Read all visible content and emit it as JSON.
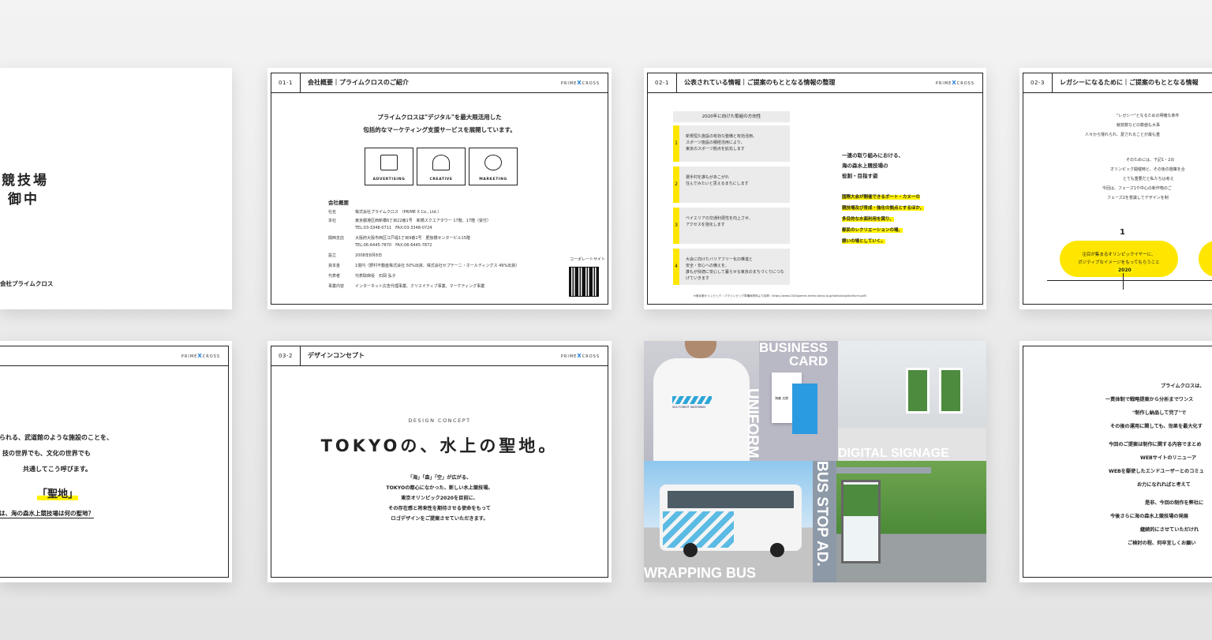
{
  "slide_a": {
    "line1": "競技場",
    "line2": "御中",
    "footer": "会社プライムクロス"
  },
  "slide_b": {
    "num": "01-1",
    "title": "会社概要｜プライムクロスのご紹介",
    "logo_left": "PRIME",
    "logo_x": "X",
    "logo_right": "CROSS",
    "lead1": "プライムクロスは\"デジタル\"を最大限活用した",
    "lead2": "包括的なマーケティング支援サービスを展開しています。",
    "services": [
      "ADVERTISING",
      "CREATIVE",
      "MARKETING"
    ],
    "company_heading": "会社概要",
    "rows": [
      {
        "k": "社名",
        "v": "株式会社プライムクロス （PRIME X Co., Ltd.）"
      },
      {
        "k": "本社",
        "v": "東京都港区西新橋6丁目22番1号　新橋スクエアタワー 17階、17階（受付）"
      },
      {
        "k": "",
        "v": "TEL:03-3348-0711　FAX:03-3348-0724"
      },
      {
        "k": "関西支店",
        "v": "大阪府大阪市西区江戸堀1丁目9番1号　肥後橋センタービル15階"
      },
      {
        "k": "",
        "v": "TEL:06-6445-7870　FAX:06-6445-7872"
      },
      {
        "k": "設立",
        "v": "2008年8月8日"
      },
      {
        "k": "資本金",
        "v": "1億円（野村不動産株式会社 50%出資、株式会社セプテーニ・ホールディングス 49%出資）"
      },
      {
        "k": "代表者",
        "v": "代表取締役　石岡 弘子"
      },
      {
        "k": "事業内容",
        "v": "インターネット広告代理事業、クリエイティブ事業、マーケティング事業"
      }
    ],
    "qr_label": "コーポレートサイト"
  },
  "slide_c": {
    "num": "02-1",
    "title": "公表されている情報｜ご提案のもととなる情報の整理",
    "table_heading": "2020年に向けた取組の方向性",
    "items": [
      {
        "n": "1",
        "t1": "新規恒久施設の有効な整備と有効活用、",
        "t2": "スポーツ施設の積極活用により、",
        "t3": "東京のスポーツ拠点を拡充します"
      },
      {
        "n": "2",
        "t1": "選手村を誰もがあこがれ",
        "t2": "住んでみたいと思えるまちにします",
        "t3": ""
      },
      {
        "n": "3",
        "t1": "ベイエリアの交通利便性を向上させ、",
        "t2": "アクセスを強化します",
        "t3": ""
      },
      {
        "n": "4",
        "t1": "大会に向けたバリアフリー化の推進と",
        "t2": "安全・安心への備えを、",
        "t3": "誰もが快適に安心して暮らせる東京のまちづくりにつなげていきます"
      }
    ],
    "right1": "一連の取り組みにおける、",
    "right2": "海の森水上競技場の",
    "right3": "役割・目指す姿",
    "hl": [
      "国際大会が開催できるボート・カヌーの",
      "競技場及び育成・強化の拠点とするほか、",
      "多目的な水面利用を図り、",
      "都民のレクリエーションの場、",
      "憩いの場としていく。"
    ],
    "source": "※東京都オリンピック・パラリンピック準備局資料より抜粋（https://www.2020games.metro.tokyo.lg.jp/taiikukaigi/torikumi.pdf）"
  },
  "slide_d": {
    "num": "02-3",
    "title": "レガシーになるために｜ご提案のもととなる情報",
    "lines": [
      "\"レガシー\"となるための明確な条件",
      "競技数などの数値も大事",
      "人々から憧れられ、愛されることが最も重"
    ],
    "lines2": [
      "そのためには、下記1・2の",
      "オリンピック開催時と、その後の施策を合",
      "とても重要だと私たちは考え",
      "今回は、フェーズ1や中心の新作物のご",
      "フェーズ2を意識してデザインを制"
    ],
    "phase": "1",
    "bubble1": "注目が集まるオリンピックイヤーに、",
    "bubble2": "ポジティブなイメージをもってもらうこと",
    "year": "2020"
  },
  "slide_e": {
    "logo_left": "PRIME",
    "logo_x": "X",
    "logo_right": "CROSS",
    "l1": "られる、武道館のような施設のことを、",
    "l2": "技の世界でも、文化の世界でも",
    "l3": "共通してこう呼びます。",
    "quote": "「聖地」",
    "link": "は、海の森水上競技場は何の聖地？"
  },
  "slide_f": {
    "num": "03-2",
    "title": "デザインコンセプト",
    "logo_left": "PRIME",
    "logo_x": "X",
    "logo_right": "CROSS",
    "eyebrow": "DESIGN CONCEPT",
    "headline": "TOKYOの、水上の聖地。",
    "body": [
      "「海」「森」「空」が広がる、",
      "TOKYOの都心になかった、新しい水上競技場。",
      "東京オリンピック2020を目前に、",
      "その存在感と将来性を期待させる使命をもって",
      "ロゴデザインをご提案させていただきます。"
    ]
  },
  "slide_g": {
    "business": "BUSINESS",
    "card": "CARD",
    "uniform": "UNIFORM",
    "digital": "DIGITAL SIGNAGE",
    "busstop": "BUS STOP AD.",
    "wrapping": "WRAPPING BUS",
    "shirt_text": "SEA FOREST WATERWAY",
    "card_name": "海森 太郎"
  },
  "slide_h": {
    "lines": [
      "プライムクロスは、",
      "一貫体制で戦略提案から分析までワンス",
      "\"制作し納品して完了\"で",
      "その後の運用に関しても、効果を最大化す",
      "今回のご提案は制作に関する内容でまとめ",
      "WEBサイトのリニューア",
      "WEBを駆使したエンドユーザーとのコミュ",
      "お力になれればと考えて",
      "是非、今回の制作を弊社に",
      "今後さらに海の森水上競技場の発展",
      "継続的にさせていただけれ",
      "ご検討の程、何卒宜しくお願い"
    ]
  },
  "colors": {
    "accent_yellow": "#ffe600",
    "logo_blue": "#1a7ad9",
    "ink": "#222222"
  }
}
